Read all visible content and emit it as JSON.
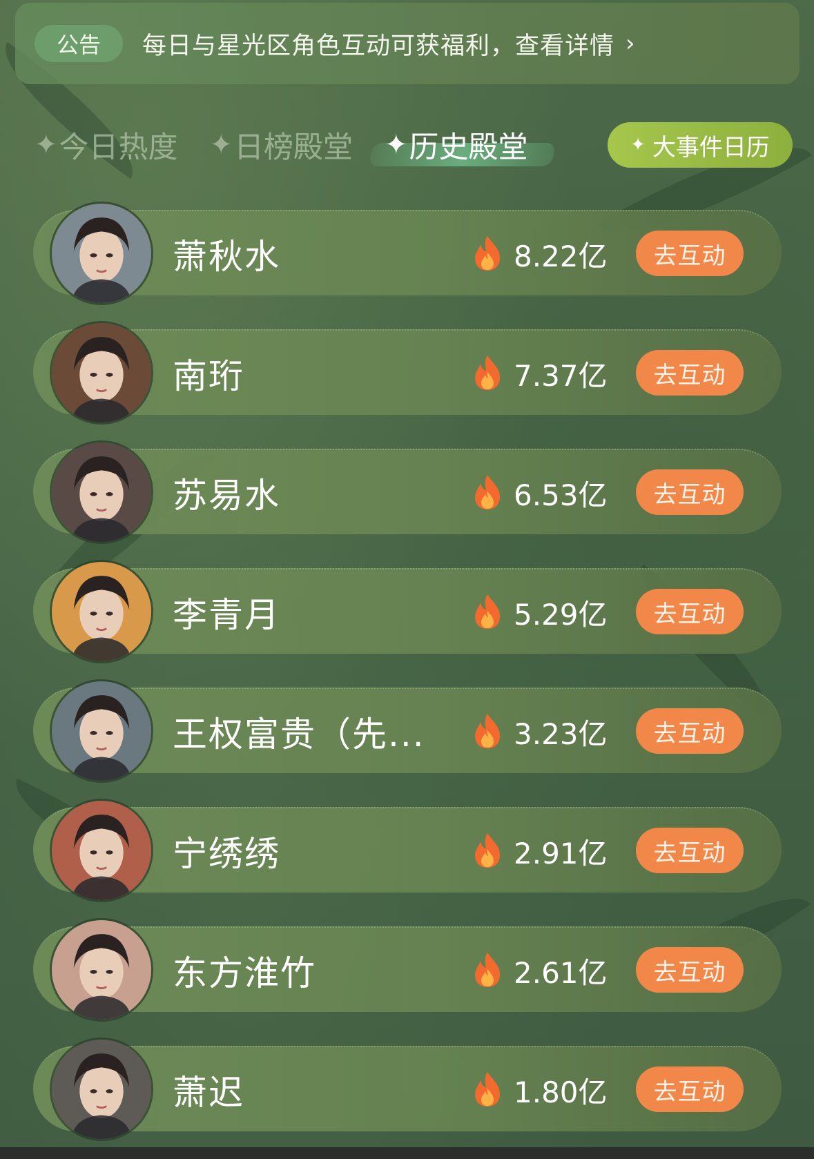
{
  "announcement": {
    "badge": "公告",
    "text": "每日与星光区角色互动可获福利，查看详情",
    "arrow": "›"
  },
  "tabs": [
    {
      "label": "今日热度",
      "active": false
    },
    {
      "label": "日榜殿堂",
      "active": false
    },
    {
      "label": "历史殿堂",
      "active": true
    }
  ],
  "tab_spark": "✦",
  "calendar_button": {
    "label": "大事件日历",
    "spark": "✦"
  },
  "rows": [
    {
      "name": "萧秋水",
      "heat": "8.22亿",
      "action": "去互动",
      "avatar_color": "#7d8a92"
    },
    {
      "name": "南珩",
      "heat": "7.37亿",
      "action": "去互动",
      "avatar_color": "#6b4a38"
    },
    {
      "name": "苏易水",
      "heat": "6.53亿",
      "action": "去互动",
      "avatar_color": "#5a4a46"
    },
    {
      "name": "李青月",
      "heat": "5.29亿",
      "action": "去互动",
      "avatar_color": "#d89a4a"
    },
    {
      "name": "王权富贵（先...",
      "heat": "3.23亿",
      "action": "去互动",
      "avatar_color": "#6a7880"
    },
    {
      "name": "宁绣绣",
      "heat": "2.91亿",
      "action": "去互动",
      "avatar_color": "#b0604a"
    },
    {
      "name": "东方淮竹",
      "heat": "2.61亿",
      "action": "去互动",
      "avatar_color": "#c8a090"
    },
    {
      "name": "萧迟",
      "heat": "1.80亿",
      "action": "去互动",
      "avatar_color": "#5e5a55"
    }
  ]
}
